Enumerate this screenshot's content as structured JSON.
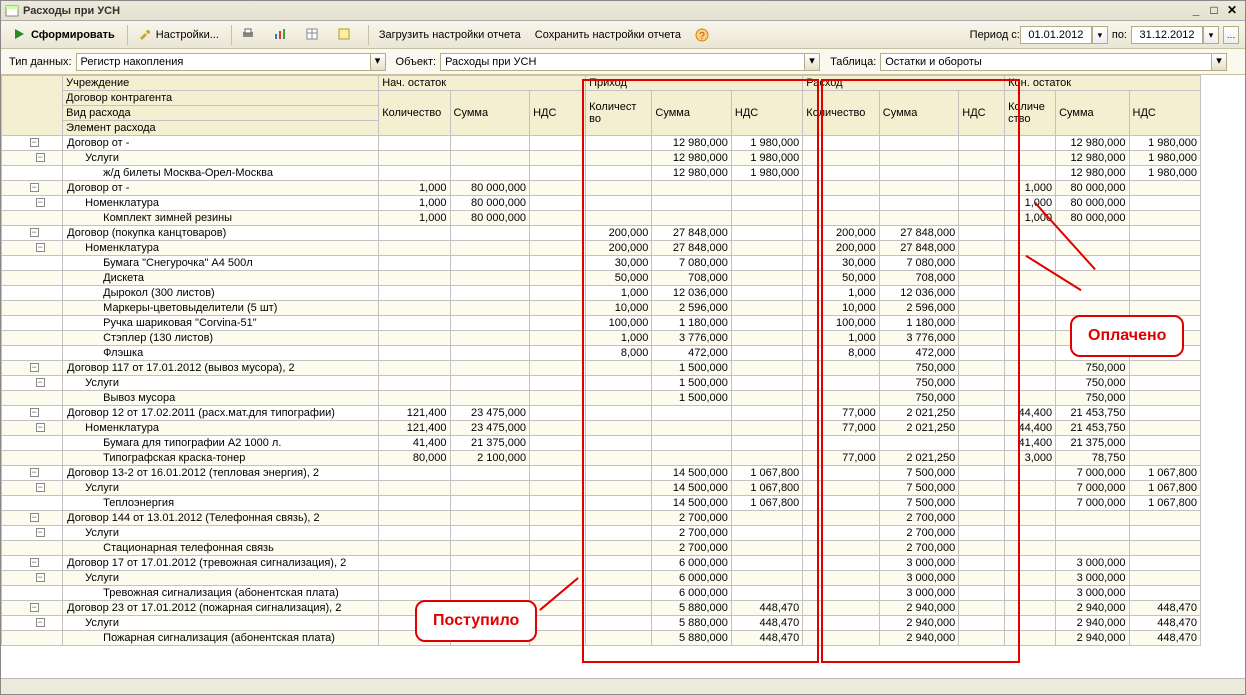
{
  "window": {
    "title": "Расходы при УСН"
  },
  "toolbar": {
    "form": "Сформировать",
    "settings": "Настройки...",
    "load": "Загрузить настройки отчета",
    "save": "Сохранить настройки отчета",
    "period_label": "Период с:",
    "date_from": "01.01.2012",
    "to": "по:",
    "date_to": "31.12.2012"
  },
  "filters": {
    "type_label": "Тип данных:",
    "type_value": "Регистр накопления",
    "object_label": "Объект:",
    "object_value": "Расходы при УСН",
    "table_label": "Таблица:",
    "table_value": "Остатки и обороты"
  },
  "headers": {
    "inst": "Учреждение",
    "contract": "Договор контрагента",
    "exp_kind": "Вид расхода",
    "exp_elem": "Элемент расхода",
    "start": "Нач. остаток",
    "in": "Приход",
    "out": "Расход",
    "end": "Кон. остаток",
    "qty": "Количество",
    "qty_s": "Количест\nво",
    "qty_e": "Количе\nство",
    "sum": "Сумма",
    "vat": "НДС"
  },
  "callouts": {
    "arrived": "Поступило",
    "paid": "Оплачено"
  },
  "rows": [
    {
      "indent": 0,
      "label": "Договор  от -",
      "in_sum": "12 980,000",
      "in_vat": "1 980,000",
      "end_sum": "12 980,000",
      "end_vat": "1 980,000"
    },
    {
      "indent": 1,
      "label": "Услуги",
      "in_sum": "12 980,000",
      "in_vat": "1 980,000",
      "end_sum": "12 980,000",
      "end_vat": "1 980,000"
    },
    {
      "indent": 2,
      "label": "ж/д билеты Москва-Орел-Москва",
      "in_sum": "12 980,000",
      "in_vat": "1 980,000",
      "end_sum": "12 980,000",
      "end_vat": "1 980,000"
    },
    {
      "indent": 0,
      "label": "Договор  от -",
      "start_qty": "1,000",
      "start_sum": "80 000,000",
      "end_qty": "1,000",
      "end_sum": "80 000,000"
    },
    {
      "indent": 1,
      "label": "Номенклатура",
      "start_qty": "1,000",
      "start_sum": "80 000,000",
      "end_qty": "1,000",
      "end_sum": "80 000,000"
    },
    {
      "indent": 2,
      "label": "Комплект зимней резины",
      "start_qty": "1,000",
      "start_sum": "80 000,000",
      "end_qty": "1,000",
      "end_sum": "80 000,000"
    },
    {
      "indent": 0,
      "label": "Договор (покупка канцтоваров)",
      "in_qty": "200,000",
      "in_sum": "27 848,000",
      "out_qty": "200,000",
      "out_sum": "27 848,000"
    },
    {
      "indent": 1,
      "label": "Номенклатура",
      "in_qty": "200,000",
      "in_sum": "27 848,000",
      "out_qty": "200,000",
      "out_sum": "27 848,000"
    },
    {
      "indent": 2,
      "label": "Бумага \"Снегурочка\" А4 500л",
      "in_qty": "30,000",
      "in_sum": "7 080,000",
      "out_qty": "30,000",
      "out_sum": "7 080,000"
    },
    {
      "indent": 2,
      "label": "Дискета",
      "in_qty": "50,000",
      "in_sum": "708,000",
      "out_qty": "50,000",
      "out_sum": "708,000"
    },
    {
      "indent": 2,
      "label": "Дырокол (300 листов)",
      "in_qty": "1,000",
      "in_sum": "12 036,000",
      "out_qty": "1,000",
      "out_sum": "12 036,000"
    },
    {
      "indent": 2,
      "label": "Маркеры-цветовыделители (5 шт)",
      "in_qty": "10,000",
      "in_sum": "2 596,000",
      "out_qty": "10,000",
      "out_sum": "2 596,000"
    },
    {
      "indent": 2,
      "label": "Ручка шариковая \"Corvina-51\"",
      "in_qty": "100,000",
      "in_sum": "1 180,000",
      "out_qty": "100,000",
      "out_sum": "1 180,000"
    },
    {
      "indent": 2,
      "label": "Стэплер (130 листов)",
      "in_qty": "1,000",
      "in_sum": "3 776,000",
      "out_qty": "1,000",
      "out_sum": "3 776,000"
    },
    {
      "indent": 2,
      "label": "Флэшка",
      "in_qty": "8,000",
      "in_sum": "472,000",
      "out_qty": "8,000",
      "out_sum": "472,000"
    },
    {
      "indent": 0,
      "label": "Договор 117 от 17.01.2012 (вывоз мусора), 2",
      "in_sum": "1 500,000",
      "out_sum": "750,000",
      "end_sum": "750,000"
    },
    {
      "indent": 1,
      "label": "Услуги",
      "in_sum": "1 500,000",
      "out_sum": "750,000",
      "end_sum": "750,000"
    },
    {
      "indent": 2,
      "label": "Вывоз мусора",
      "in_sum": "1 500,000",
      "out_sum": "750,000",
      "end_sum": "750,000"
    },
    {
      "indent": 0,
      "label": "Договор 12 от 17.02.2011 (расх.мат.для типографии)",
      "start_qty": "121,400",
      "start_sum": "23 475,000",
      "out_qty": "77,000",
      "out_sum": "2 021,250",
      "end_qty": "44,400",
      "end_sum": "21 453,750"
    },
    {
      "indent": 1,
      "label": "Номенклатура",
      "start_qty": "121,400",
      "start_sum": "23 475,000",
      "out_qty": "77,000",
      "out_sum": "2 021,250",
      "end_qty": "44,400",
      "end_sum": "21 453,750"
    },
    {
      "indent": 2,
      "label": "Бумага для типографии А2 1000 л.",
      "start_qty": "41,400",
      "start_sum": "21 375,000",
      "end_qty": "41,400",
      "end_sum": "21 375,000"
    },
    {
      "indent": 2,
      "label": "Типографская краска-тонер",
      "start_qty": "80,000",
      "start_sum": "2 100,000",
      "out_qty": "77,000",
      "out_sum": "2 021,250",
      "end_qty": "3,000",
      "end_sum": "78,750"
    },
    {
      "indent": 0,
      "label": "Договор 13-2 от 16.01.2012 (тепловая энергия), 2",
      "in_sum": "14 500,000",
      "in_vat": "1 067,800",
      "out_sum": "7 500,000",
      "end_sum": "7 000,000",
      "end_vat": "1 067,800"
    },
    {
      "indent": 1,
      "label": "Услуги",
      "in_sum": "14 500,000",
      "in_vat": "1 067,800",
      "out_sum": "7 500,000",
      "end_sum": "7 000,000",
      "end_vat": "1 067,800"
    },
    {
      "indent": 2,
      "label": "Теплоэнергия",
      "in_sum": "14 500,000",
      "in_vat": "1 067,800",
      "out_sum": "7 500,000",
      "end_sum": "7 000,000",
      "end_vat": "1 067,800"
    },
    {
      "indent": 0,
      "label": "Договор 144 от 13.01.2012 (Телефонная связь), 2",
      "in_sum": "2 700,000",
      "out_sum": "2 700,000"
    },
    {
      "indent": 1,
      "label": "Услуги",
      "in_sum": "2 700,000",
      "out_sum": "2 700,000"
    },
    {
      "indent": 2,
      "label": "Стационарная телефонная связь",
      "in_sum": "2 700,000",
      "out_sum": "2 700,000"
    },
    {
      "indent": 0,
      "label": "Договор 17 от 17.01.2012 (тревожная сигнализация), 2",
      "in_sum": "6 000,000",
      "out_sum": "3 000,000",
      "end_sum": "3 000,000"
    },
    {
      "indent": 1,
      "label": "Услуги",
      "in_sum": "6 000,000",
      "out_sum": "3 000,000",
      "end_sum": "3 000,000"
    },
    {
      "indent": 2,
      "label": "Тревожная сигнализация (абонентская плата)",
      "in_sum": "6 000,000",
      "out_sum": "3 000,000",
      "end_sum": "3 000,000"
    },
    {
      "indent": 0,
      "label": "Договор 23 от 17.01.2012 (пожарная сигнализация), 2",
      "in_sum": "5 880,000",
      "in_vat": "448,470",
      "out_sum": "2 940,000",
      "end_sum": "2 940,000",
      "end_vat": "448,470"
    },
    {
      "indent": 1,
      "label": "Услуги",
      "in_sum": "5 880,000",
      "in_vat": "448,470",
      "out_sum": "2 940,000",
      "end_sum": "2 940,000",
      "end_vat": "448,470"
    },
    {
      "indent": 2,
      "label": "Пожарная сигнализация (абонентская плата)",
      "in_sum": "5 880,000",
      "in_vat": "448,470",
      "out_sum": "2 940,000",
      "end_sum": "2 940,000",
      "end_vat": "448,470"
    }
  ]
}
